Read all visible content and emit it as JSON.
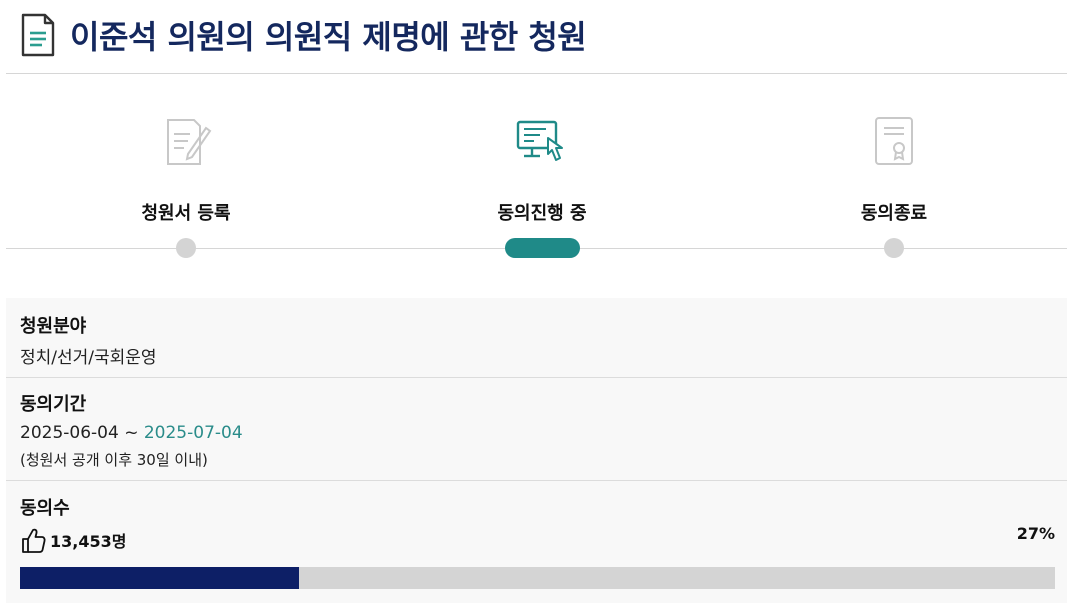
{
  "page_title": "이준석 의원의 의원직 제명에 관한 청원",
  "steps": [
    {
      "label": "청원서 등록",
      "icon": "document-pen-icon",
      "state": "done"
    },
    {
      "label": "동의진행 중",
      "icon": "monitor-click-icon",
      "state": "active"
    },
    {
      "label": "동의종료",
      "icon": "certificate-icon",
      "state": "pending"
    }
  ],
  "info": {
    "category_label": "청원분야",
    "category_value": "정치/선거/국회운영",
    "period_label": "동의기간",
    "period_start": "2025-06-04 ~ ",
    "period_end": "2025-07-04",
    "period_note": "(청원서 공개 이후 30일 이내)",
    "count_label": "동의수",
    "count_value": "13,453명",
    "percent_text": "27%",
    "progress_fraction": 0.27
  },
  "colors": {
    "title": "#14285e",
    "accent": "#1f8a88",
    "progress": "#0d1f66",
    "track": "#d4d4d4"
  }
}
